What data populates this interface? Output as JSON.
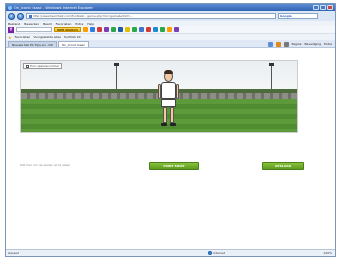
{
  "window": {
    "title": "On_Iconic Isaac - Windows Internet Explorer"
  },
  "address": {
    "url": "http://www.teamtalk.com/football/...game.php?do=game&kitid=...",
    "search_engine": "Google",
    "back_icon": "back-arrow-icon",
    "forward_icon": "forward-arrow-icon"
  },
  "menu": {
    "items": [
      "Bestand",
      "Bewerken",
      "Beeld",
      "Favorieten",
      "Extra",
      "Help"
    ]
  },
  "toolbar": {
    "brand": "Y",
    "search_label": "WEB SEARCH"
  },
  "favorites": {
    "label": "Favorieten",
    "items": [
      "Voorgestelde sites",
      "Scottish kit"
    ]
  },
  "tabs": {
    "items": [
      "Nieuwe tab PC Tips en - DK",
      "On_Iconic Isaac"
    ],
    "tools": [
      "Pagina",
      "Beveiliging",
      "Extra"
    ]
  },
  "app": {
    "checkbox_label": "Toon spelersnummer",
    "hint_text": "Klik hier om de speler op te slaan",
    "button_primary": "PRINT SHIRT",
    "button_secondary": "OPSLAAN"
  },
  "status": {
    "text": "Gereed",
    "zone": "Internet",
    "zoom": "100%"
  },
  "colors": {
    "titlebar": "#2f63b3",
    "button_green": "#6aab28",
    "pitch": "#5c9a3a"
  }
}
